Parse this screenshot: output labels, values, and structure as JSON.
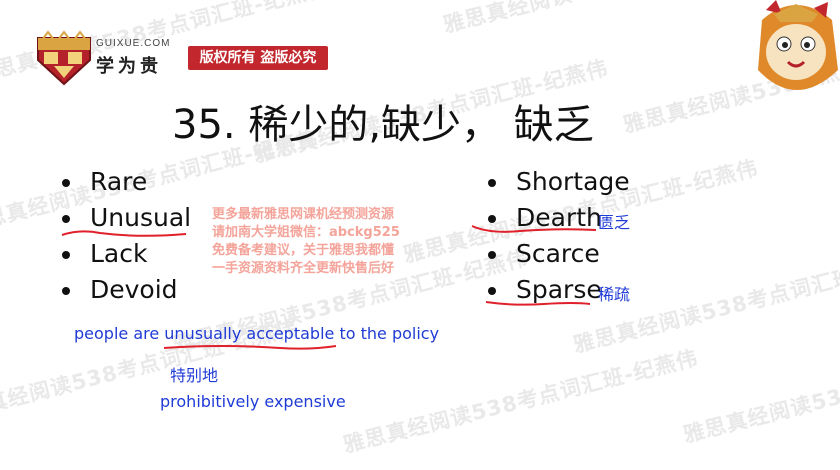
{
  "watermark": {
    "text": "雅思真经阅读538考点词汇班-纪燕伟"
  },
  "header": {
    "domain": "GUIXUE.COM",
    "brand_name": "学为贵",
    "copyright_badge": "版权所有 盗版必究"
  },
  "slide": {
    "title": "35. 稀少的,缺少，  缺乏",
    "left_terms": [
      "Rare",
      "Unusual",
      "Lack",
      "Devoid"
    ],
    "right_terms": [
      "Shortage",
      "Dearth",
      "Scarce",
      "Sparse"
    ],
    "notes": {
      "dearth": "匮乏",
      "sparse": "稀疏"
    },
    "promo_lines": [
      "更多最新雅思网课机经预测资源",
      "请加南大学姐微信：abckg525",
      "免费备考建议，关于雅思我都懂",
      "一手资源资料齐全更新快售后好"
    ],
    "example": {
      "before": "people are ",
      "highlight": "unusually acceptable",
      "after": " to the policy",
      "translation": "特别地",
      "second": "prohibitively expensive"
    }
  },
  "colors": {
    "accent_red": "#c1272d",
    "ink_blue": "#1f3bd6",
    "promo": "#f4a49a",
    "underline_red": "#e0202a"
  }
}
